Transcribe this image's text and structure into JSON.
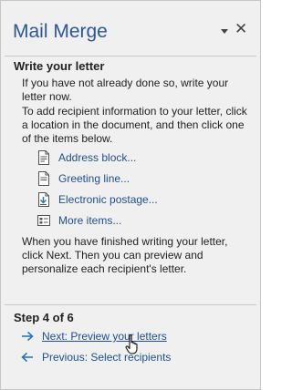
{
  "pane": {
    "title": "Mail Merge",
    "dropdown_icon": "dropdown-arrow-icon",
    "close_label": "✕"
  },
  "write_section": {
    "heading": "Write your letter",
    "intro": "If you have not already done so, write your letter now.",
    "instructions": "To add recipient information to your letter, click a location in the document, and then click one of the items below.",
    "items": [
      {
        "label": "Address block...",
        "icon": "address-block-icon"
      },
      {
        "label": "Greeting line...",
        "icon": "greeting-line-icon"
      },
      {
        "label": "Electronic postage...",
        "icon": "electronic-postage-icon"
      },
      {
        "label": "More items...",
        "icon": "more-items-icon"
      }
    ],
    "closing": "When you have finished writing your letter, click Next. Then you can preview and personalize each recipient's letter."
  },
  "footer": {
    "step": "Step 4 of 6",
    "next": "Next: Preview your letters",
    "previous": "Previous: Select recipients"
  },
  "colors": {
    "title": "#2b579a",
    "link": "#1f4e8f",
    "arrow": "#2e75b6",
    "background": "#f0f0f0"
  }
}
